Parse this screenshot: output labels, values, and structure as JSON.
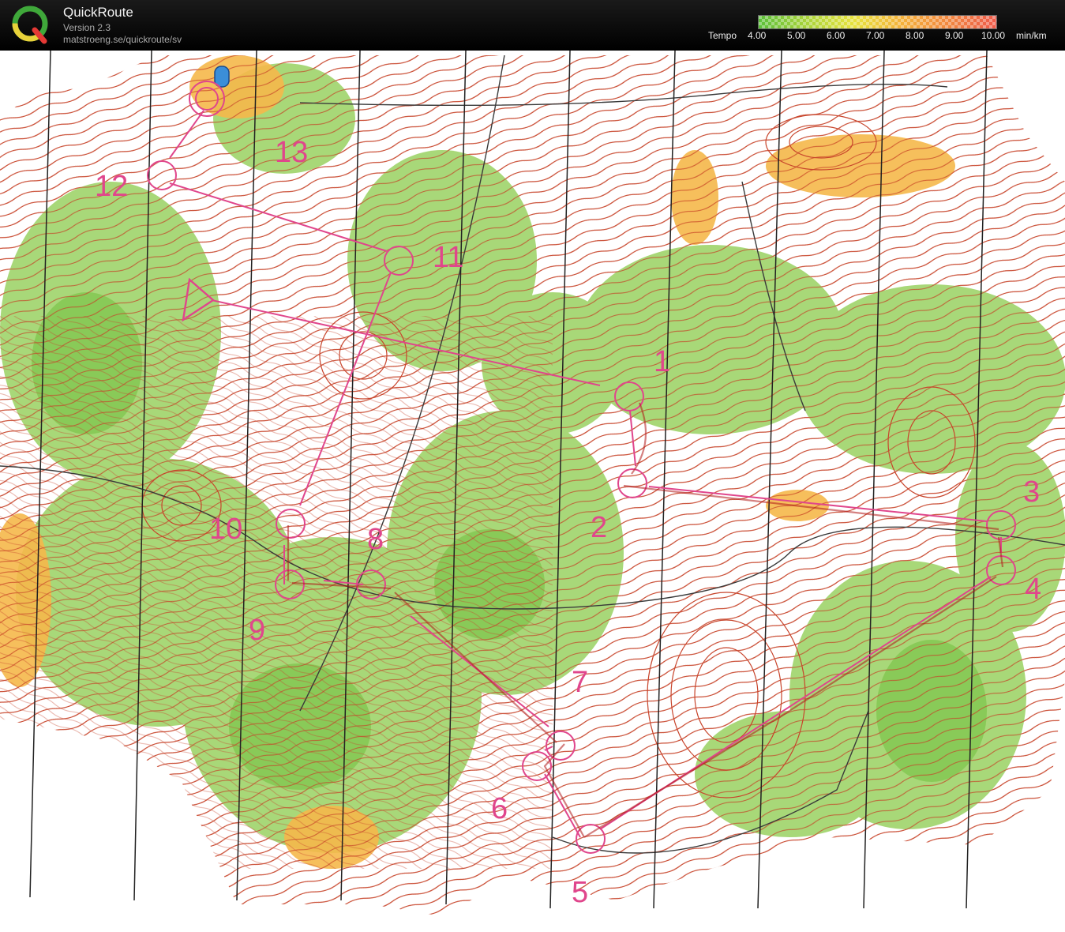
{
  "app": {
    "title": "QuickRoute",
    "version": "Version 2.3",
    "url": "matstroeng.se/quickroute/sv",
    "logo_letter": "Q"
  },
  "legend": {
    "label": "Tempo",
    "ticks": [
      "4.00",
      "5.00",
      "6.00",
      "7.00",
      "8.00",
      "9.00",
      "10.00"
    ],
    "unit": "min/km",
    "colors": [
      "#5bbf3a",
      "#a9d43a",
      "#e8e33d",
      "#f4b23a",
      "#f2873f",
      "#ef5a4a"
    ]
  },
  "map": {
    "colors": {
      "paper": "#ffffff",
      "forest_green": "#9fd46a",
      "dark_green": "#6fbf3e",
      "open_yellow": "#f5b84a",
      "contour": "#c8452c",
      "course": "#e0468c",
      "track": "#3a3a3a"
    },
    "controls": [
      "1",
      "2",
      "3",
      "4",
      "5",
      "6",
      "7",
      "8",
      "9",
      "10",
      "11",
      "12",
      "13"
    ]
  }
}
